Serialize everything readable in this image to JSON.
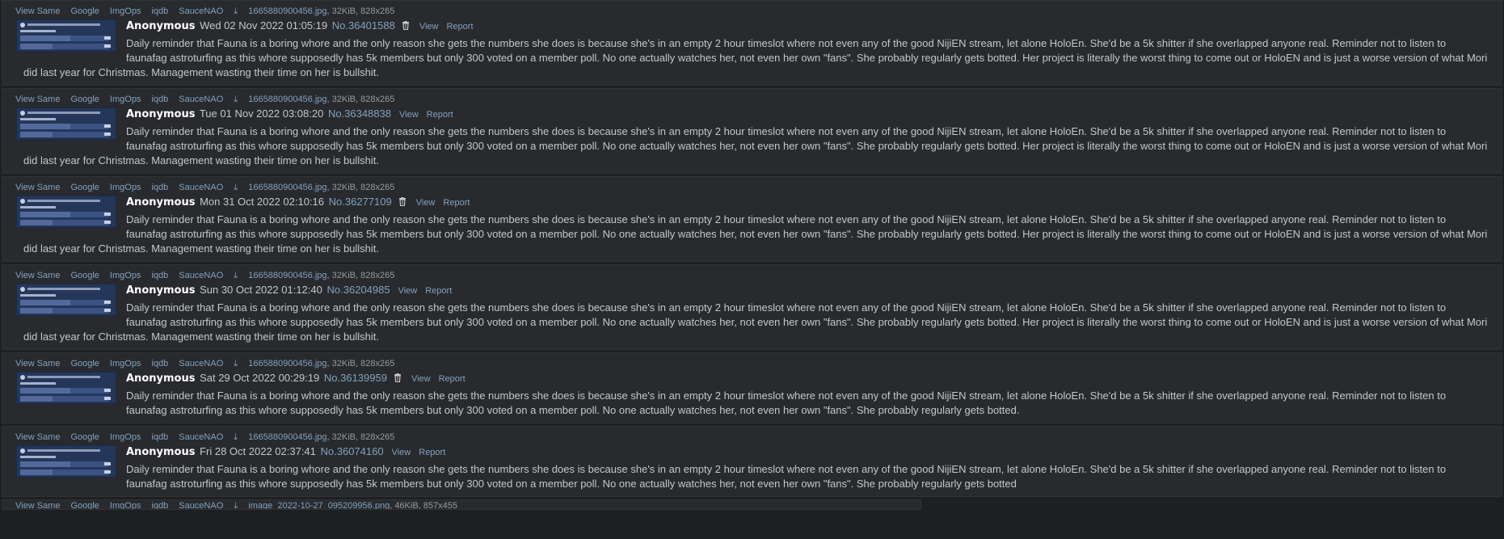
{
  "filebar": {
    "links": [
      "View Same",
      "Google",
      "ImgOps",
      "iqdb",
      "SauceNAO"
    ],
    "download_icon": "download-icon"
  },
  "icons": {
    "delete": "trash-icon"
  },
  "colors": {
    "background": "#1d1f21",
    "post_bg": "#282a2e",
    "link": "#81a2be",
    "text": "#c5c8c6",
    "name": "#ffffff"
  },
  "posts": [
    {
      "filename": "1665880900456.jpg",
      "fileinfo": ", 32KiB, 828x265",
      "name": "Anonymous",
      "date": "Wed 02 Nov 2022 01:05:19",
      "number": "No.36401588",
      "has_delete": true,
      "view": "View",
      "report": "Report",
      "comment": "Daily reminder that Fauna is a boring whore and the only reason she gets the numbers she does is because she's in an empty 2 hour timeslot where not even any of the good NijiEN stream, let alone HoloEn. She'd be a 5k shitter if she overlapped anyone real. Reminder not to listen to faunafag astroturfing as this whore supposedly has 5k members but only 300 voted on a member poll. No one actually watches her, not even her own \"fans\". She probably regularly gets botted. Her project is literally the worst thing to come out or HoloEN and is just a worse version of what Mori did last year for Christmas. Management wasting their time on her is bullshit."
    },
    {
      "filename": "1665880900456.jpg",
      "fileinfo": ", 32KiB, 828x265",
      "name": "Anonymous",
      "date": "Tue 01 Nov 2022 03:08:20",
      "number": "No.36348838",
      "has_delete": false,
      "view": "View",
      "report": "Report",
      "comment": "Daily reminder that Fauna is a boring whore and the only reason she gets the numbers she does is because she's in an empty 2 hour timeslot where not even any of the good NijiEN stream, let alone HoloEn. She'd be a 5k shitter if she overlapped anyone real. Reminder not to listen to faunafag astroturfing as this whore supposedly has 5k members but only 300 voted on a member poll. No one actually watches her, not even her own \"fans\". She probably regularly gets botted. Her project is literally the worst thing to come out or HoloEN and is just a worse version of what Mori did last year for Christmas. Management wasting their time on her is bullshit."
    },
    {
      "filename": "1665880900456.jpg",
      "fileinfo": ", 32KiB, 828x265",
      "name": "Anonymous",
      "date": "Mon 31 Oct 2022 02:10:16",
      "number": "No.36277109",
      "has_delete": true,
      "view": "View",
      "report": "Report",
      "comment": "Daily reminder that Fauna is a boring whore and the only reason she gets the numbers she does is because she's in an empty 2 hour timeslot where not even any of the good NijiEN stream, let alone HoloEn. She'd be a 5k shitter if she overlapped anyone real. Reminder not to listen to faunafag astroturfing as this whore supposedly has 5k members but only 300 voted on a member poll. No one actually watches her, not even her own \"fans\". She probably regularly gets botted. Her project is literally the worst thing to come out or HoloEN and is just a worse version of what Mori did last year for Christmas. Management wasting their time on her is bullshit."
    },
    {
      "filename": "1665880900456.jpg",
      "fileinfo": ", 32KiB, 828x265",
      "name": "Anonymous",
      "date": "Sun 30 Oct 2022 01:12:40",
      "number": "No.36204985",
      "has_delete": false,
      "view": "View",
      "report": "Report",
      "comment": "Daily reminder that Fauna is a boring whore and the only reason she gets the numbers she does is because she's in an empty 2 hour timeslot where not even any of the good NijiEN stream, let alone HoloEn. She'd be a 5k shitter if she overlapped anyone real. Reminder not to listen to faunafag astroturfing as this whore supposedly has 5k members but only 300 voted on a member poll. No one actually watches her, not even her own \"fans\". She probably regularly gets botted. Her project is literally the worst thing to come out or HoloEN and is just a worse version of what Mori did last year for Christmas. Management wasting their time on her is bullshit."
    },
    {
      "filename": "1665880900456.jpg",
      "fileinfo": ", 32KiB, 828x265",
      "name": "Anonymous",
      "date": "Sat 29 Oct 2022 00:29:19",
      "number": "No.36139959",
      "has_delete": true,
      "view": "View",
      "report": "Report",
      "comment": "Daily reminder that Fauna is a boring whore and the only reason she gets the numbers she does is because she's in an empty 2 hour timeslot where not even any of the good NijiEN stream, let alone HoloEn. She'd be a 5k shitter if she overlapped anyone real. Reminder not to listen to faunafag astroturfing as this whore supposedly has 5k members but only 300 voted on a member poll. No one actually watches her, not even her own \"fans\". She probably regularly gets botted."
    },
    {
      "filename": "1665880900456.jpg",
      "fileinfo": ", 32KiB, 828x265",
      "name": "Anonymous",
      "date": "Fri 28 Oct 2022 02:37:41",
      "number": "No.36074160",
      "has_delete": false,
      "view": "View",
      "report": "Report",
      "comment": "Daily reminder that Fauna is a boring whore and the only reason she gets the numbers she does is because she's in an empty 2 hour timeslot where not even any of the good NijiEN stream, let alone HoloEn. She'd be a 5k shitter if she overlapped anyone real. Reminder not to listen to faunafag astroturfing as this whore supposedly has 5k members but only 300 voted on a member poll. No one actually watches her, not even her own \"fans\". She probably regularly gets botted"
    }
  ],
  "partial_post": {
    "filename": "image_2022-10-27_095209956.png",
    "fileinfo": ", 46KiB, 857x455"
  }
}
